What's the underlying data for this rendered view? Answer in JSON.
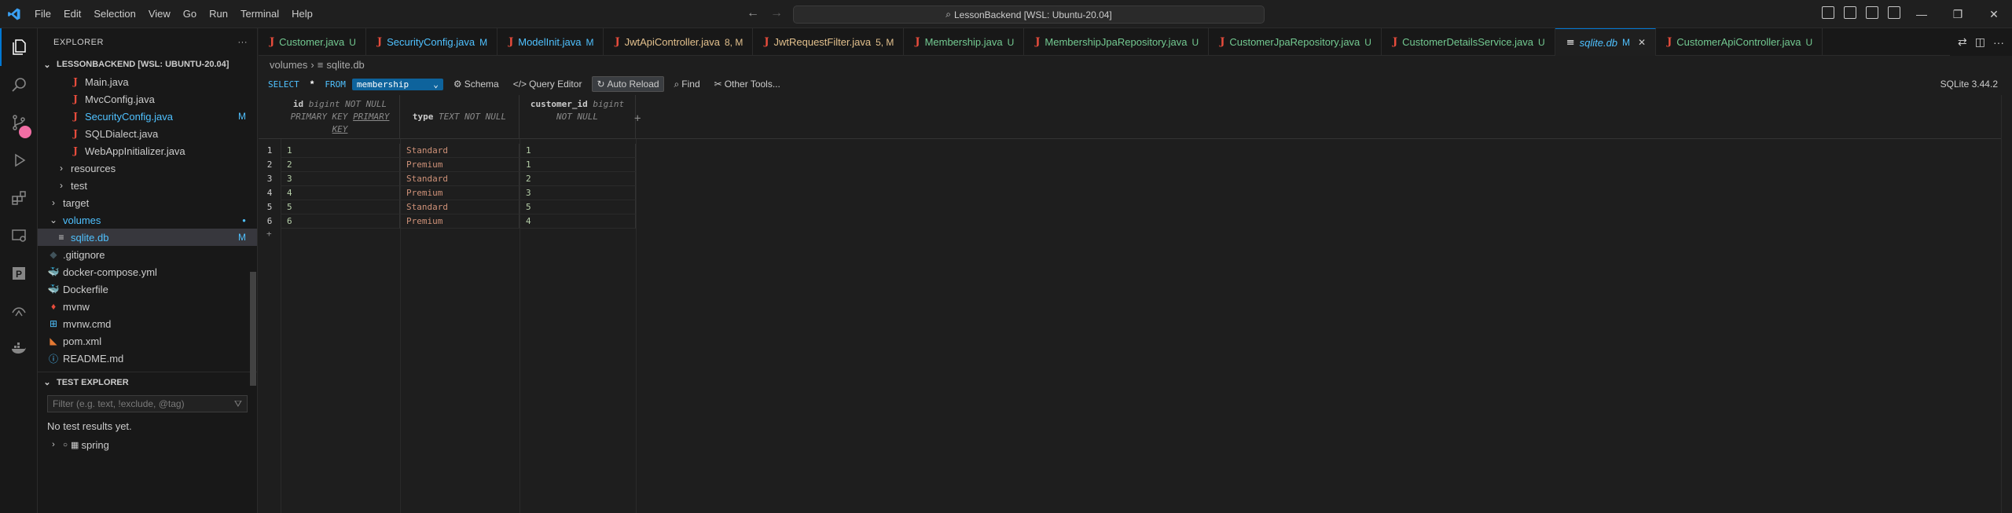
{
  "titlebar": {
    "menu": [
      "File",
      "Edit",
      "Selection",
      "View",
      "Go",
      "Run",
      "Terminal",
      "Help"
    ],
    "command_center": "LessonBackend [WSL: Ubuntu-20.04]"
  },
  "explorer": {
    "header": "EXPLORER",
    "more": "···",
    "root": "LESSONBACKEND [WSL: UBUNTU-20.04]",
    "items": [
      {
        "label": "Main.java",
        "kind": "java",
        "deco": ""
      },
      {
        "label": "MvcConfig.java",
        "kind": "java",
        "deco": ""
      },
      {
        "label": "SecurityConfig.java",
        "kind": "java",
        "deco": "M"
      },
      {
        "label": "SQLDialect.java",
        "kind": "java",
        "deco": ""
      },
      {
        "label": "WebAppInitializer.java",
        "kind": "java",
        "deco": ""
      },
      {
        "label": "resources",
        "kind": "folder",
        "deco": ""
      },
      {
        "label": "test",
        "kind": "folder",
        "deco": ""
      },
      {
        "label": "target",
        "kind": "folder",
        "deco": ""
      },
      {
        "label": "volumes",
        "kind": "folder-open",
        "deco": "●"
      },
      {
        "label": "sqlite.db",
        "kind": "db",
        "deco": "M"
      },
      {
        "label": ".gitignore",
        "kind": "git",
        "deco": ""
      },
      {
        "label": "docker-compose.yml",
        "kind": "docker",
        "deco": ""
      },
      {
        "label": "Dockerfile",
        "kind": "docker",
        "deco": ""
      },
      {
        "label": "mvnw",
        "kind": "mvn",
        "deco": ""
      },
      {
        "label": "mvnw.cmd",
        "kind": "win",
        "deco": ""
      },
      {
        "label": "pom.xml",
        "kind": "rss",
        "deco": ""
      },
      {
        "label": "README.md",
        "kind": "info",
        "deco": ""
      }
    ]
  },
  "test_explorer": {
    "title": "TEST EXPLORER",
    "filter_placeholder": "Filter (e.g. text, !exclude, @tag)",
    "empty": "No test results yet.",
    "node": "spring"
  },
  "tabs": [
    {
      "label": "Customer.java",
      "suffix": "U",
      "color": "#73c991",
      "icon": "J"
    },
    {
      "label": "SecurityConfig.java",
      "suffix": "M",
      "color": "#4fc1ff",
      "icon": "J"
    },
    {
      "label": "ModelInit.java",
      "suffix": "M",
      "color": "#4fc1ff",
      "icon": "J"
    },
    {
      "label": "JwtApiController.java",
      "suffix": "8, M",
      "color": "#e2c08d",
      "icon": "J"
    },
    {
      "label": "JwtRequestFilter.java",
      "suffix": "5, M",
      "color": "#e2c08d",
      "icon": "J"
    },
    {
      "label": "Membership.java",
      "suffix": "U",
      "color": "#73c991",
      "icon": "J"
    },
    {
      "label": "MembershipJpaRepository.java",
      "suffix": "U",
      "color": "#73c991",
      "icon": "J"
    },
    {
      "label": "CustomerJpaRepository.java",
      "suffix": "U",
      "color": "#73c991",
      "icon": "J"
    },
    {
      "label": "CustomerDetailsService.java",
      "suffix": "U",
      "color": "#73c991",
      "icon": "J"
    },
    {
      "label": "sqlite.db",
      "suffix": "M",
      "color": "#4fc1ff",
      "icon": "≡",
      "active": true
    },
    {
      "label": "CustomerApiController.java",
      "suffix": "U",
      "color": "#73c991",
      "icon": "J"
    }
  ],
  "breadcrumb": [
    "volumes",
    "sqlite.db"
  ],
  "sqlite": {
    "select": "SELECT",
    "star": "*",
    "from": "FROM",
    "table": "membership",
    "schema": "Schema",
    "query_editor": "Query Editor",
    "auto_reload": "Auto Reload",
    "find": "Find",
    "other_tools": "Other Tools...",
    "version": "SQLite 3.44.2"
  },
  "grid": {
    "columns": [
      {
        "name": "id",
        "type": "bigint NOT NULL",
        "extra1": "PRIMARY KEY",
        "extra2": "PRIMARY",
        "extra3": "KEY"
      },
      {
        "name": "type",
        "type": "TEXT NOT NULL"
      },
      {
        "name": "customer_id",
        "type": "bigint",
        "extra1": "NOT NULL"
      }
    ],
    "rows": [
      {
        "n": "1",
        "id": "1",
        "type": "Standard",
        "customer_id": "1"
      },
      {
        "n": "2",
        "id": "2",
        "type": "Premium",
        "customer_id": "1"
      },
      {
        "n": "3",
        "id": "3",
        "type": "Standard",
        "customer_id": "2"
      },
      {
        "n": "4",
        "id": "4",
        "type": "Premium",
        "customer_id": "3"
      },
      {
        "n": "5",
        "id": "5",
        "type": "Standard",
        "customer_id": "5"
      },
      {
        "n": "6",
        "id": "6",
        "type": "Premium",
        "customer_id": "4"
      }
    ],
    "add_row": "+",
    "add_col": "+"
  }
}
